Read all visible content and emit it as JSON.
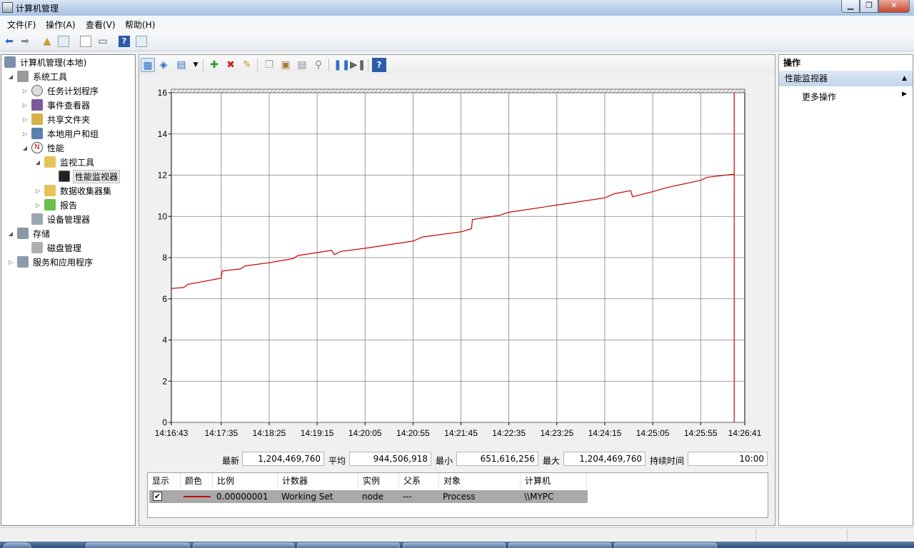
{
  "window": {
    "title": "计算机管理"
  },
  "menu": [
    "文件(F)",
    "操作(A)",
    "查看(V)",
    "帮助(H)"
  ],
  "tree": [
    {
      "id": "root",
      "label": "计算机管理(本地)",
      "icon": "computer-management-icon",
      "expander": ""
    },
    {
      "id": "system-tools",
      "label": "系统工具",
      "icon": "tools-icon",
      "expander": "◢"
    },
    {
      "id": "task-scheduler",
      "label": "任务计划程序",
      "icon": "clock-icon",
      "expander": "▷"
    },
    {
      "id": "event-viewer",
      "label": "事件查看器",
      "icon": "event-viewer-icon",
      "expander": "▷"
    },
    {
      "id": "shared-folders",
      "label": "共享文件夹",
      "icon": "shared-folder-icon",
      "expander": "▷"
    },
    {
      "id": "local-users",
      "label": "本地用户和组",
      "icon": "users-icon",
      "expander": "▷"
    },
    {
      "id": "performance",
      "label": "性能",
      "icon": "performance-icon",
      "expander": "◢"
    },
    {
      "id": "monitoring-tools",
      "label": "监视工具",
      "icon": "folder-icon",
      "expander": "◢"
    },
    {
      "id": "performance-monitor",
      "label": "性能监视器",
      "icon": "monitor-chart-icon",
      "expander": ""
    },
    {
      "id": "data-collector-sets",
      "label": "数据收集器集",
      "icon": "folder-icon",
      "expander": "▷"
    },
    {
      "id": "reports",
      "label": "报告",
      "icon": "report-icon",
      "expander": "▷"
    },
    {
      "id": "device-manager",
      "label": "设备管理器",
      "icon": "device-manager-icon",
      "expander": ""
    },
    {
      "id": "storage",
      "label": "存储",
      "icon": "storage-icon",
      "expander": "◢"
    },
    {
      "id": "disk-management",
      "label": "磁盘管理",
      "icon": "disk-icon",
      "expander": ""
    },
    {
      "id": "services-apps",
      "label": "服务和应用程序",
      "icon": "services-icon",
      "expander": "▷"
    }
  ],
  "chart_data": {
    "type": "line",
    "title": "",
    "xlabel": "",
    "ylabel": "",
    "ylim": [
      0,
      16
    ],
    "yticks": [
      0,
      2,
      4,
      6,
      8,
      10,
      12,
      14,
      16
    ],
    "xticks": [
      "14:16:43",
      "14:17:35",
      "14:18:25",
      "14:19:15",
      "14:20:05",
      "14:20:55",
      "14:21:45",
      "14:22:35",
      "14:23:25",
      "14:24:15",
      "14:25:05",
      "14:25:55",
      "14:26:41"
    ],
    "grid": true,
    "series": [
      {
        "color": "#cc0000",
        "values_unit": "scaled (x 0.00000001)",
        "points": [
          [
            "14:16:43",
            6.5
          ],
          [
            "14:16:56",
            6.55
          ],
          [
            "14:17:00",
            6.7
          ],
          [
            "14:17:35",
            7.0
          ],
          [
            "14:17:36",
            7.35
          ],
          [
            "14:17:55",
            7.45
          ],
          [
            "14:18:00",
            7.6
          ],
          [
            "14:18:25",
            7.75
          ],
          [
            "14:18:50",
            7.95
          ],
          [
            "14:18:55",
            8.1
          ],
          [
            "14:19:30",
            8.35
          ],
          [
            "14:19:33",
            8.15
          ],
          [
            "14:19:40",
            8.3
          ],
          [
            "14:20:05",
            8.45
          ],
          [
            "14:20:55",
            8.8
          ],
          [
            "14:21:05",
            9.0
          ],
          [
            "14:21:45",
            9.25
          ],
          [
            "14:21:56",
            9.4
          ],
          [
            "14:21:57",
            9.85
          ],
          [
            "14:22:25",
            10.05
          ],
          [
            "14:22:35",
            10.2
          ],
          [
            "14:23:25",
            10.55
          ],
          [
            "14:24:15",
            10.9
          ],
          [
            "14:24:25",
            11.1
          ],
          [
            "14:24:42",
            11.25
          ],
          [
            "14:24:44",
            10.95
          ],
          [
            "14:25:05",
            11.2
          ],
          [
            "14:25:20",
            11.4
          ],
          [
            "14:25:55",
            11.75
          ],
          [
            "14:26:02",
            11.9
          ],
          [
            "14:26:30",
            12.05
          ]
        ]
      }
    ],
    "current_time_marker": "14:26:30"
  },
  "stats": {
    "last_label": "最新",
    "last": "1,204,469,760",
    "avg_label": "平均",
    "avg": "944,506,918",
    "min_label": "最小",
    "min": "651,616,256",
    "max_label": "最大",
    "max": "1,204,469,760",
    "duration_label": "持续时间",
    "duration": "10:00"
  },
  "counters": {
    "headers": [
      "显示",
      "颜色",
      "比例",
      "计数器",
      "实例",
      "父系",
      "对象",
      "计算机"
    ],
    "rows": [
      {
        "show": "✔",
        "color": "#cc0000",
        "scale": "0.00000001",
        "counter": "Working Set",
        "instance": "node",
        "parent": "---",
        "object": "Process",
        "computer": "\\\\MYPC"
      }
    ]
  },
  "actions": {
    "title": "操作",
    "section": "性能监视器",
    "more": "更多操作"
  }
}
